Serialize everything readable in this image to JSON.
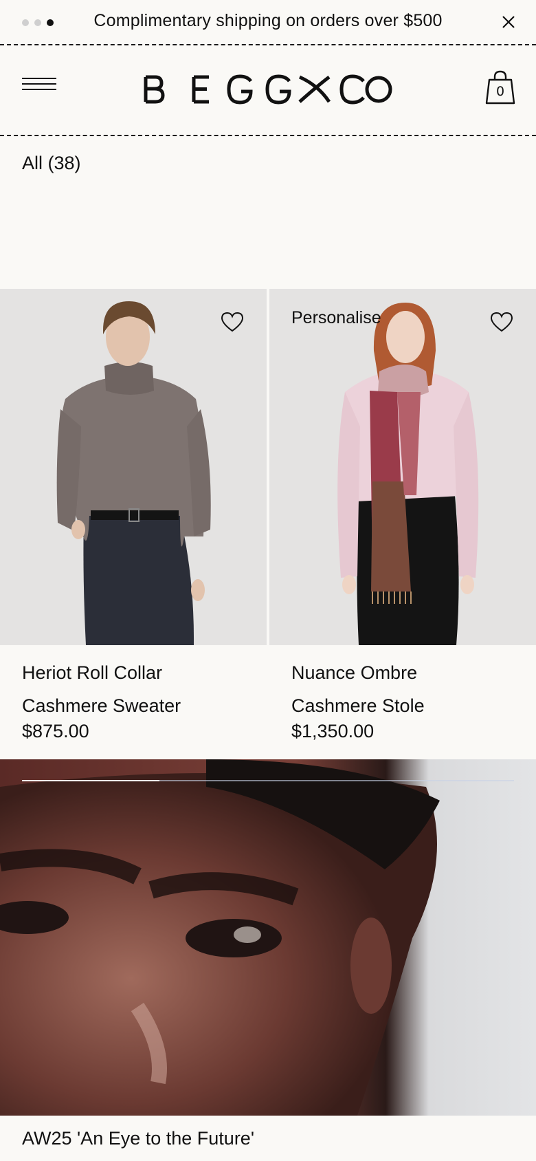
{
  "announcement": {
    "text": "Complimentary shipping on orders over $500",
    "slide_count": 3,
    "active_slide": 3,
    "close_icon": "close-icon"
  },
  "header": {
    "menu_icon": "hamburger-menu-icon",
    "logo": "BEGG x CO",
    "bag_icon": "shopping-bag-icon",
    "bag_count": "0"
  },
  "filter": {
    "label": "All (38)"
  },
  "products": [
    {
      "name_line1": "Heriot Roll Collar",
      "name_line2": "Cashmere Sweater",
      "price": "$875.00",
      "tag": "",
      "wishlist_icon": "heart-icon"
    },
    {
      "name_line1": "Nuance Ombre",
      "name_line2": "Cashmere Stole",
      "price": "$1,350.00",
      "tag": "Personalise",
      "wishlist_icon": "heart-icon"
    }
  ],
  "video": {
    "progress": 0.28,
    "caption": "AW25 'An Eye to the Future'"
  },
  "colors": {
    "background": "#faf9f6",
    "text": "#111111",
    "image_bg": "#e4e3e2"
  }
}
